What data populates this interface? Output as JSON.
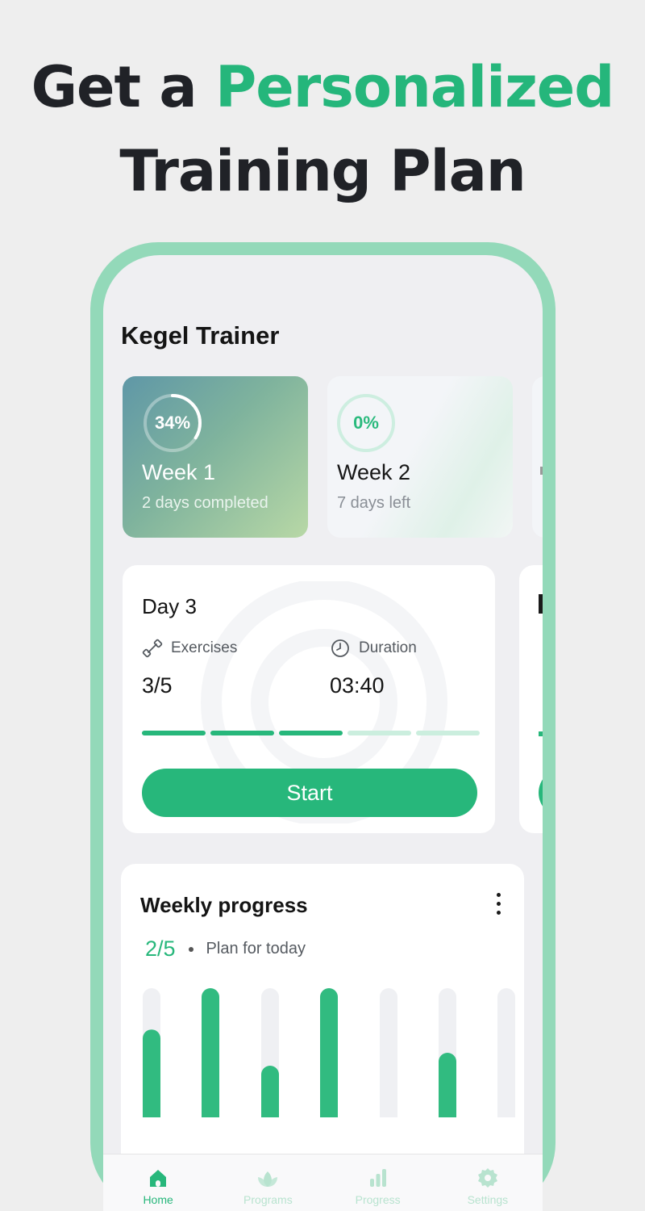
{
  "headline": {
    "line1_prefix": "Get a ",
    "line1_accent": "Personalized",
    "line2": "Training Plan"
  },
  "app": {
    "title": "Kegel Trainer"
  },
  "weeks": [
    {
      "percent_label": "34%",
      "progress": 0.34,
      "name": "Week 1",
      "subtitle": "2 days completed"
    },
    {
      "percent_label": "0%",
      "progress": 0.0,
      "name": "Week 2",
      "subtitle": "7 days left"
    }
  ],
  "day": {
    "title": "Day 3",
    "exercises_label": "Exercises",
    "exercises_value": "3/5",
    "duration_label": "Duration",
    "duration_value": "03:40",
    "segments_done": 3,
    "segments_total": 5,
    "start_label": "Start"
  },
  "weekly_progress": {
    "title": "Weekly progress",
    "count": "2/5",
    "plan_label": "Plan for today",
    "bars": [
      0.68,
      1.0,
      0.4,
      1.0,
      0.0,
      0.5,
      0.0
    ]
  },
  "tabs": [
    {
      "label": "Home",
      "icon": "home-icon",
      "active": true
    },
    {
      "label": "Programs",
      "icon": "lotus-icon",
      "active": false
    },
    {
      "label": "Progress",
      "icon": "bar-chart-icon",
      "active": false
    },
    {
      "label": "Settings",
      "icon": "gear-icon",
      "active": false
    }
  ],
  "colors": {
    "accent": "#27b77b",
    "accent_light": "#cbeede",
    "phone_frame": "#93d9b9"
  }
}
